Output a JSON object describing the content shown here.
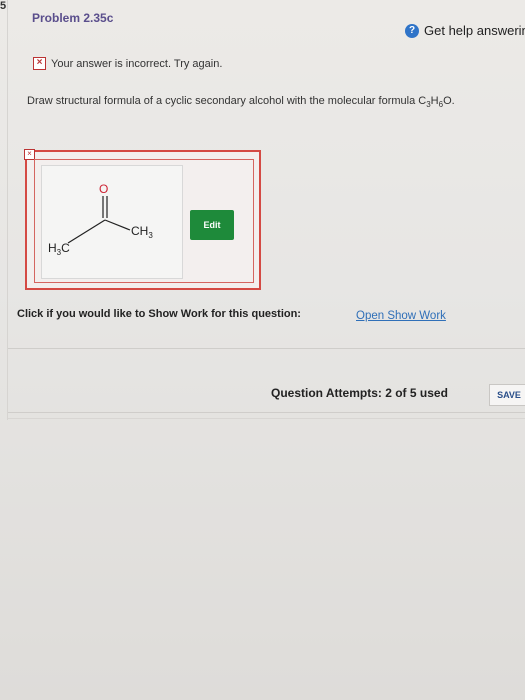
{
  "edge_mark": "5",
  "problem": {
    "title": "Problem 2.35c"
  },
  "help": {
    "label": "Get help answerin"
  },
  "feedback": {
    "icon": "x-icon",
    "text": "Your answer is incorrect.  Try again."
  },
  "instruction": {
    "text_prefix": "Draw structural formula of a cyclic secondary alcohol with the molecular formula C",
    "sub1": "3",
    "mid1": "H",
    "sub2": "6",
    "suffix": "O."
  },
  "structure": {
    "oxygen": "O",
    "ch3_right": "CH",
    "ch3_right_sub": "3",
    "h3c_left": "H",
    "h3c_left_sub": "3",
    "h3c_left_tail": "C"
  },
  "edit_button": {
    "label": "Edit"
  },
  "show_work": {
    "prompt": "Click if you would like to Show Work for this question:",
    "link": "Open Show Work"
  },
  "attempts": {
    "text": "Question Attempts: 2 of 5 used"
  },
  "save_button": {
    "label": "SAVE"
  }
}
